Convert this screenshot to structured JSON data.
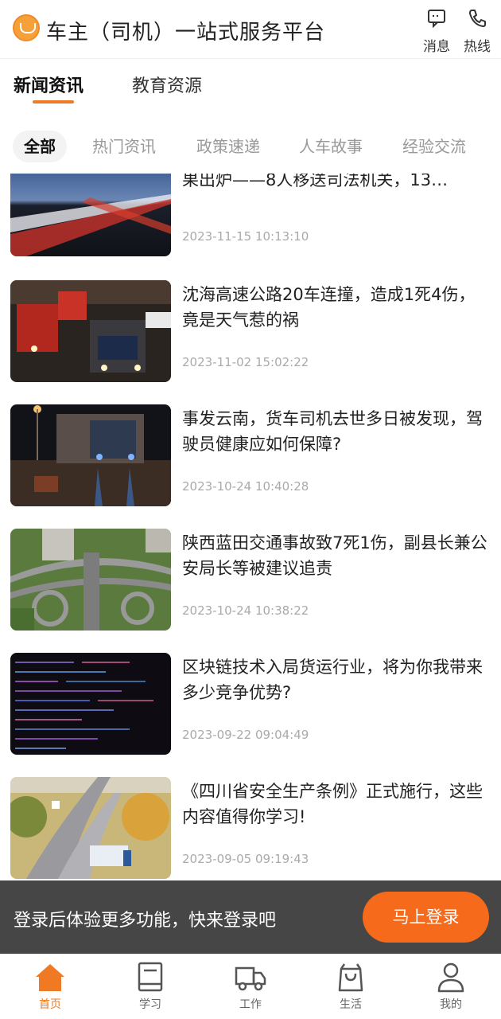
{
  "header": {
    "title": "车主（司机）一站式服务平台",
    "message_label": "消息",
    "hotline_label": "热线"
  },
  "main_tabs": [
    {
      "label": "新闻资讯",
      "active": true
    },
    {
      "label": "教育资源",
      "active": false
    }
  ],
  "categories": [
    {
      "label": "全部",
      "active": true
    },
    {
      "label": "热门资讯",
      "active": false
    },
    {
      "label": "政策速递",
      "active": false
    },
    {
      "label": "人车故事",
      "active": false
    },
    {
      "label": "经验交流",
      "active": false
    }
  ],
  "news": [
    {
      "title": "果出炉——8人移送司法机关，13…",
      "time": "2023-11-15 10:13:10",
      "thumb": "highway-night-icon"
    },
    {
      "title": "沈海高速公路20车连撞，造成1死4伤，竟是天气惹的祸",
      "time": "2023-11-02 15:02:22",
      "thumb": "truck-traffic-icon"
    },
    {
      "title": "事发云南，货车司机去世多日被发现，驾驶员健康应如何保障?",
      "time": "2023-10-24 10:40:28",
      "thumb": "truck-night-icon"
    },
    {
      "title": "陕西蓝田交通事故致7死1伤，副县长兼公安局长等被建议追责",
      "time": "2023-10-24 10:38:22",
      "thumb": "interchange-icon"
    },
    {
      "title": "区块链技术入局货运行业，将为你我带来多少竞争优势?",
      "time": "2023-09-22 09:04:49",
      "thumb": "code-screen-icon"
    },
    {
      "title": "《四川省安全生产条例》正式施行，这些内容值得你学习!",
      "time": "2023-09-05 09:19:43",
      "thumb": "road-truck-icon"
    }
  ],
  "login_banner": {
    "text": "登录后体验更多功能，快来登录吧",
    "button_label": "马上登录"
  },
  "tabbar": [
    {
      "label": "首页",
      "icon": "home-icon",
      "active": true
    },
    {
      "label": "学习",
      "icon": "book-icon",
      "active": false
    },
    {
      "label": "工作",
      "icon": "truck-icon",
      "active": false
    },
    {
      "label": "生活",
      "icon": "shopping-bag-icon",
      "active": false
    },
    {
      "label": "我的",
      "icon": "user-icon",
      "active": false
    }
  ],
  "colors": {
    "accent": "#f07a24",
    "login_button": "#f56a1b"
  }
}
